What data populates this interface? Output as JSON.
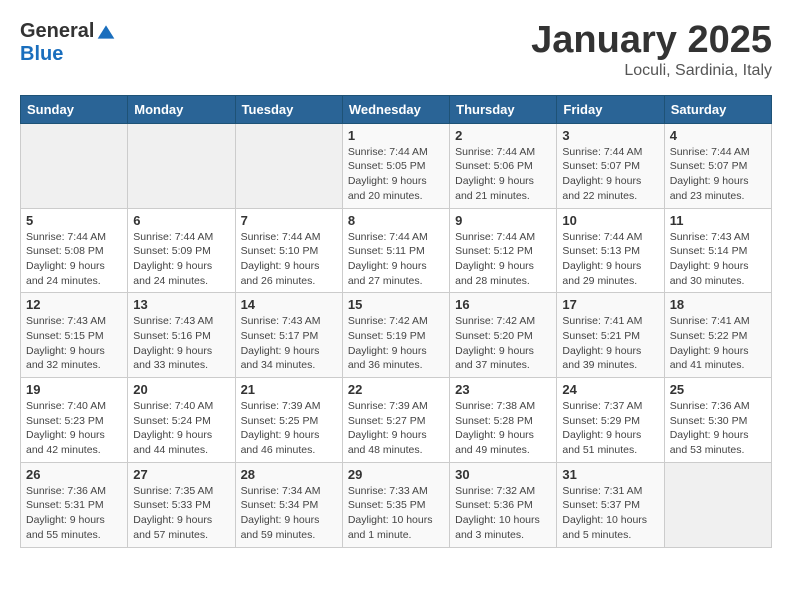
{
  "header": {
    "logo_general": "General",
    "logo_blue": "Blue",
    "month_title": "January 2025",
    "location": "Loculi, Sardinia, Italy"
  },
  "days_of_week": [
    "Sunday",
    "Monday",
    "Tuesday",
    "Wednesday",
    "Thursday",
    "Friday",
    "Saturday"
  ],
  "weeks": [
    [
      {
        "day": "",
        "info": ""
      },
      {
        "day": "",
        "info": ""
      },
      {
        "day": "",
        "info": ""
      },
      {
        "day": "1",
        "info": "Sunrise: 7:44 AM\nSunset: 5:05 PM\nDaylight: 9 hours\nand 20 minutes."
      },
      {
        "day": "2",
        "info": "Sunrise: 7:44 AM\nSunset: 5:06 PM\nDaylight: 9 hours\nand 21 minutes."
      },
      {
        "day": "3",
        "info": "Sunrise: 7:44 AM\nSunset: 5:07 PM\nDaylight: 9 hours\nand 22 minutes."
      },
      {
        "day": "4",
        "info": "Sunrise: 7:44 AM\nSunset: 5:07 PM\nDaylight: 9 hours\nand 23 minutes."
      }
    ],
    [
      {
        "day": "5",
        "info": "Sunrise: 7:44 AM\nSunset: 5:08 PM\nDaylight: 9 hours\nand 24 minutes."
      },
      {
        "day": "6",
        "info": "Sunrise: 7:44 AM\nSunset: 5:09 PM\nDaylight: 9 hours\nand 24 minutes."
      },
      {
        "day": "7",
        "info": "Sunrise: 7:44 AM\nSunset: 5:10 PM\nDaylight: 9 hours\nand 26 minutes."
      },
      {
        "day": "8",
        "info": "Sunrise: 7:44 AM\nSunset: 5:11 PM\nDaylight: 9 hours\nand 27 minutes."
      },
      {
        "day": "9",
        "info": "Sunrise: 7:44 AM\nSunset: 5:12 PM\nDaylight: 9 hours\nand 28 minutes."
      },
      {
        "day": "10",
        "info": "Sunrise: 7:44 AM\nSunset: 5:13 PM\nDaylight: 9 hours\nand 29 minutes."
      },
      {
        "day": "11",
        "info": "Sunrise: 7:43 AM\nSunset: 5:14 PM\nDaylight: 9 hours\nand 30 minutes."
      }
    ],
    [
      {
        "day": "12",
        "info": "Sunrise: 7:43 AM\nSunset: 5:15 PM\nDaylight: 9 hours\nand 32 minutes."
      },
      {
        "day": "13",
        "info": "Sunrise: 7:43 AM\nSunset: 5:16 PM\nDaylight: 9 hours\nand 33 minutes."
      },
      {
        "day": "14",
        "info": "Sunrise: 7:43 AM\nSunset: 5:17 PM\nDaylight: 9 hours\nand 34 minutes."
      },
      {
        "day": "15",
        "info": "Sunrise: 7:42 AM\nSunset: 5:19 PM\nDaylight: 9 hours\nand 36 minutes."
      },
      {
        "day": "16",
        "info": "Sunrise: 7:42 AM\nSunset: 5:20 PM\nDaylight: 9 hours\nand 37 minutes."
      },
      {
        "day": "17",
        "info": "Sunrise: 7:41 AM\nSunset: 5:21 PM\nDaylight: 9 hours\nand 39 minutes."
      },
      {
        "day": "18",
        "info": "Sunrise: 7:41 AM\nSunset: 5:22 PM\nDaylight: 9 hours\nand 41 minutes."
      }
    ],
    [
      {
        "day": "19",
        "info": "Sunrise: 7:40 AM\nSunset: 5:23 PM\nDaylight: 9 hours\nand 42 minutes."
      },
      {
        "day": "20",
        "info": "Sunrise: 7:40 AM\nSunset: 5:24 PM\nDaylight: 9 hours\nand 44 minutes."
      },
      {
        "day": "21",
        "info": "Sunrise: 7:39 AM\nSunset: 5:25 PM\nDaylight: 9 hours\nand 46 minutes."
      },
      {
        "day": "22",
        "info": "Sunrise: 7:39 AM\nSunset: 5:27 PM\nDaylight: 9 hours\nand 48 minutes."
      },
      {
        "day": "23",
        "info": "Sunrise: 7:38 AM\nSunset: 5:28 PM\nDaylight: 9 hours\nand 49 minutes."
      },
      {
        "day": "24",
        "info": "Sunrise: 7:37 AM\nSunset: 5:29 PM\nDaylight: 9 hours\nand 51 minutes."
      },
      {
        "day": "25",
        "info": "Sunrise: 7:36 AM\nSunset: 5:30 PM\nDaylight: 9 hours\nand 53 minutes."
      }
    ],
    [
      {
        "day": "26",
        "info": "Sunrise: 7:36 AM\nSunset: 5:31 PM\nDaylight: 9 hours\nand 55 minutes."
      },
      {
        "day": "27",
        "info": "Sunrise: 7:35 AM\nSunset: 5:33 PM\nDaylight: 9 hours\nand 57 minutes."
      },
      {
        "day": "28",
        "info": "Sunrise: 7:34 AM\nSunset: 5:34 PM\nDaylight: 9 hours\nand 59 minutes."
      },
      {
        "day": "29",
        "info": "Sunrise: 7:33 AM\nSunset: 5:35 PM\nDaylight: 10 hours\nand 1 minute."
      },
      {
        "day": "30",
        "info": "Sunrise: 7:32 AM\nSunset: 5:36 PM\nDaylight: 10 hours\nand 3 minutes."
      },
      {
        "day": "31",
        "info": "Sunrise: 7:31 AM\nSunset: 5:37 PM\nDaylight: 10 hours\nand 5 minutes."
      },
      {
        "day": "",
        "info": ""
      }
    ]
  ]
}
